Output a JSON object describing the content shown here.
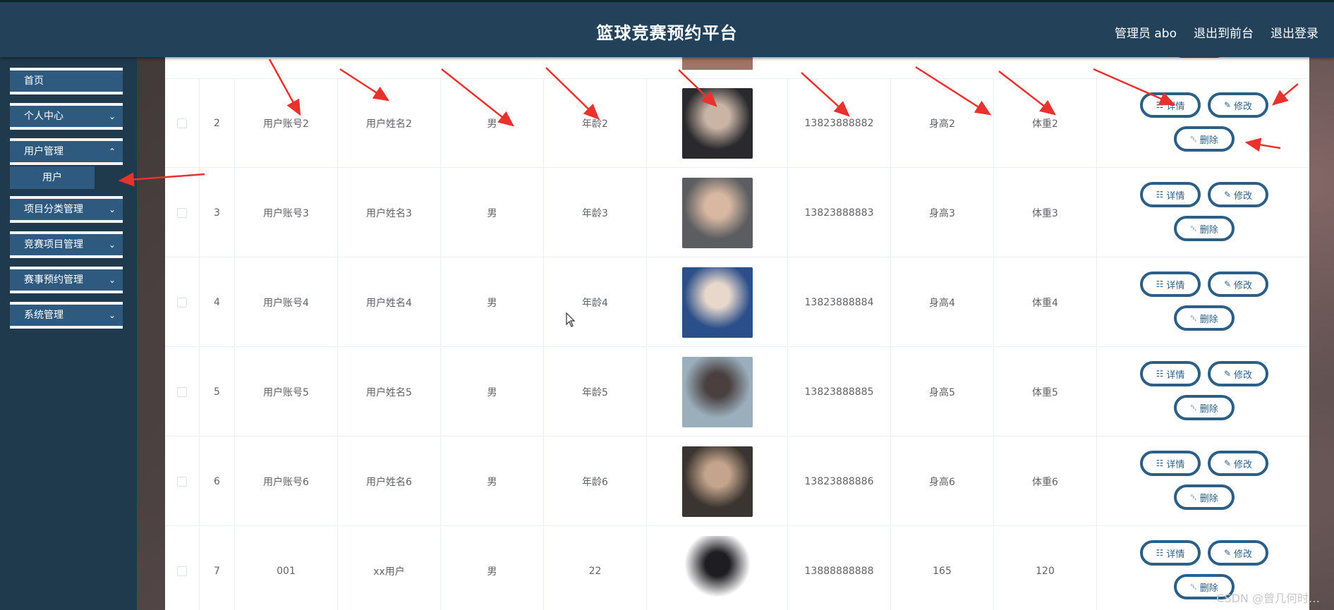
{
  "header": {
    "title": "篮球竞赛预约平台",
    "admin_label": "管理员 abo",
    "back_front": "退出到前台",
    "logout": "退出登录"
  },
  "sidebar": {
    "items": [
      {
        "label": "首页",
        "has_children": false
      },
      {
        "label": "个人中心",
        "has_children": true
      },
      {
        "label": "用户管理",
        "has_children": true
      },
      {
        "label": "项目分类管理",
        "has_children": true
      },
      {
        "label": "竞赛项目管理",
        "has_children": true
      },
      {
        "label": "赛事预约管理",
        "has_children": true
      },
      {
        "label": "系统管理",
        "has_children": true
      }
    ],
    "sub_item": "用户",
    "chevron": "chevron-down-icon"
  },
  "table": {
    "rows": [
      {
        "index": "2",
        "account": "用户账号2",
        "name": "用户姓名2",
        "gender": "男",
        "age": "年龄2",
        "phone": "13823888882",
        "height": "身高2",
        "weight": "体重2",
        "avatar_colors": [
          "#2a2a2e",
          "#c9b4a6"
        ]
      },
      {
        "index": "3",
        "account": "用户账号3",
        "name": "用户姓名3",
        "gender": "男",
        "age": "年龄3",
        "phone": "13823888883",
        "height": "身高3",
        "weight": "体重3",
        "avatar_colors": [
          "#5b5d60",
          "#d8b8a2"
        ]
      },
      {
        "index": "4",
        "account": "用户账号4",
        "name": "用户姓名4",
        "gender": "男",
        "age": "年龄4",
        "phone": "13823888884",
        "height": "身高4",
        "weight": "体重4",
        "avatar_colors": [
          "#2b4f8a",
          "#e8d8cc"
        ]
      },
      {
        "index": "5",
        "account": "用户账号5",
        "name": "用户姓名5",
        "gender": "男",
        "age": "年龄5",
        "phone": "13823888885",
        "height": "身高5",
        "weight": "体重5",
        "avatar_colors": [
          "#9aaebc",
          "#4a4040"
        ]
      },
      {
        "index": "6",
        "account": "用户账号6",
        "name": "用户姓名6",
        "gender": "男",
        "age": "年龄6",
        "phone": "13823888886",
        "height": "身高6",
        "weight": "体重6",
        "avatar_colors": [
          "#3a3530",
          "#c4a48c"
        ]
      },
      {
        "index": "7",
        "account": "001",
        "name": "xx用户",
        "gender": "男",
        "age": "22",
        "phone": "13888888888",
        "height": "165",
        "weight": "120",
        "avatar_colors": [
          "#ffffff",
          "#1e1e22"
        ]
      }
    ],
    "actions": {
      "detail": "详情",
      "edit": "修改",
      "delete": "删除"
    },
    "action_icons": [
      "document-icon",
      "pencil-icon",
      "trash-icon"
    ]
  },
  "watermark": "CSDN @曾几何时…",
  "colors": {
    "header_bg": "#23425a",
    "sidebar_bg": "#203a4d",
    "menu_bg": "#2e5a80",
    "button_border": "#2c5f86",
    "annotation_arrow": "#e8322e"
  }
}
